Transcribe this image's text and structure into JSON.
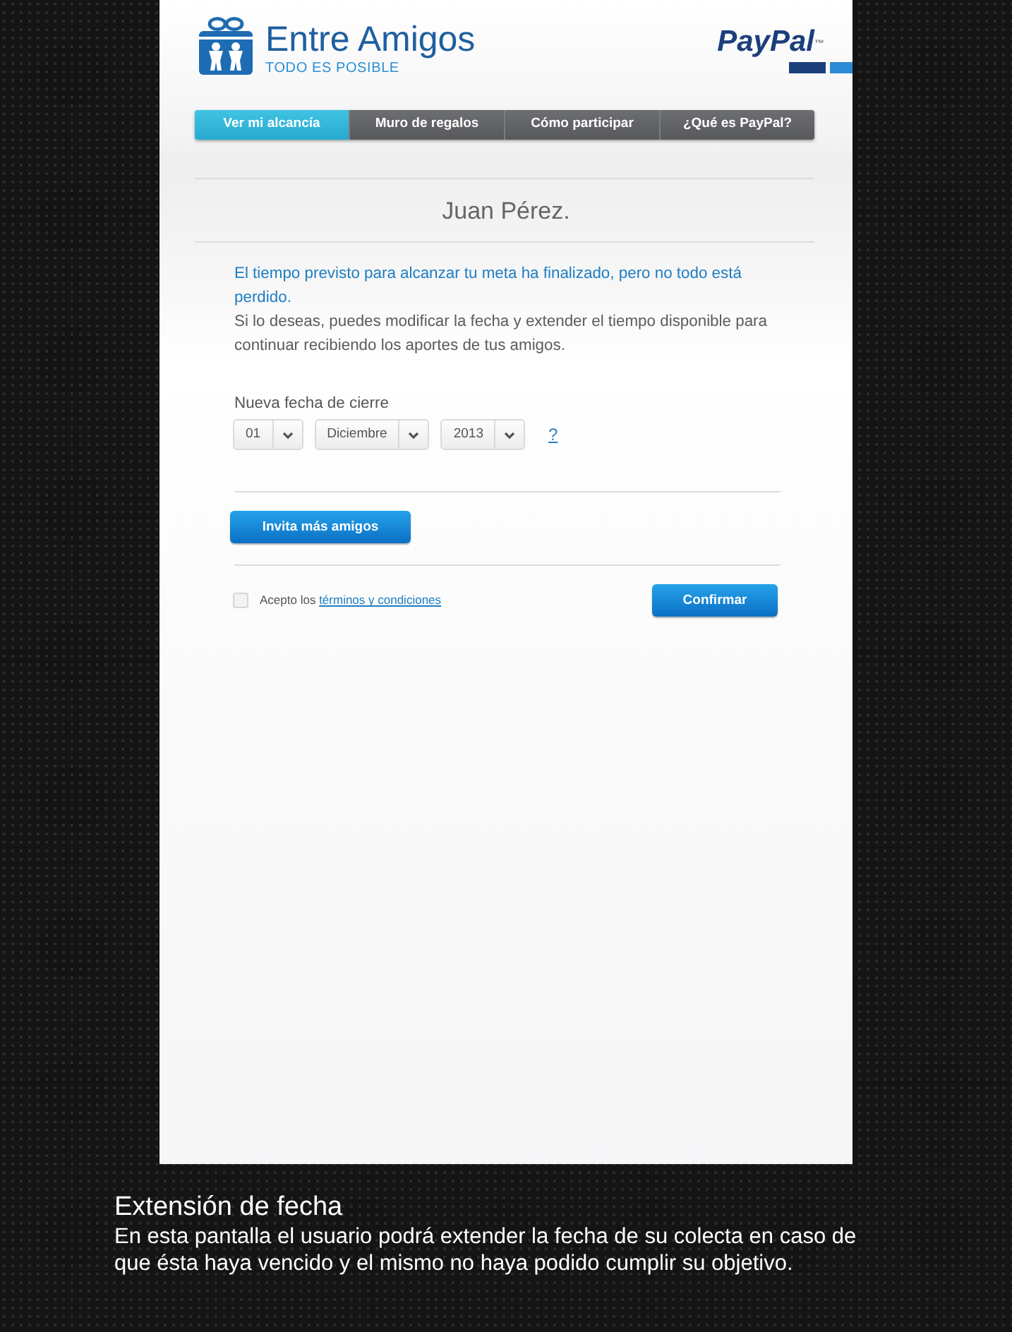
{
  "logo": {
    "title": "Entre Amigos",
    "tagline": "TODO ES POSIBLE"
  },
  "partner_logo": {
    "text": "PayPal",
    "mark": "™"
  },
  "tabs": [
    {
      "label": "Ver mi alcancía",
      "selected": true
    },
    {
      "label": "Muro de regalos",
      "selected": false
    },
    {
      "label": "Cómo participar",
      "selected": false
    },
    {
      "label": "¿Qué es PayPal?",
      "selected": false
    }
  ],
  "user_name": "Juan Pérez.",
  "message": {
    "highlight": "El tiempo previsto para alcanzar tu meta ha finalizado, pero no todo está perdido.",
    "body": "Si lo deseas, puedes modificar la fecha y extender el tiempo disponible para continuar recibiendo los aportes de tus amigos."
  },
  "date_field": {
    "label": "Nueva fecha de cierre",
    "selects": [
      {
        "value": "01"
      },
      {
        "value": "Diciembre"
      },
      {
        "value": "2013"
      }
    ],
    "help": "?"
  },
  "invite_button": "Invita más amigos",
  "terms": {
    "checked": false,
    "text": "Acepto los",
    "link": "términos y condiciones"
  },
  "confirm_button": "Confirmar",
  "caption": {
    "title": "Extensión de fecha",
    "body": "En esta pantalla el usuario podrá extender la fecha de su colecta en caso de que ésta haya vencido y el mismo no haya podido cumplir su objetivo."
  }
}
